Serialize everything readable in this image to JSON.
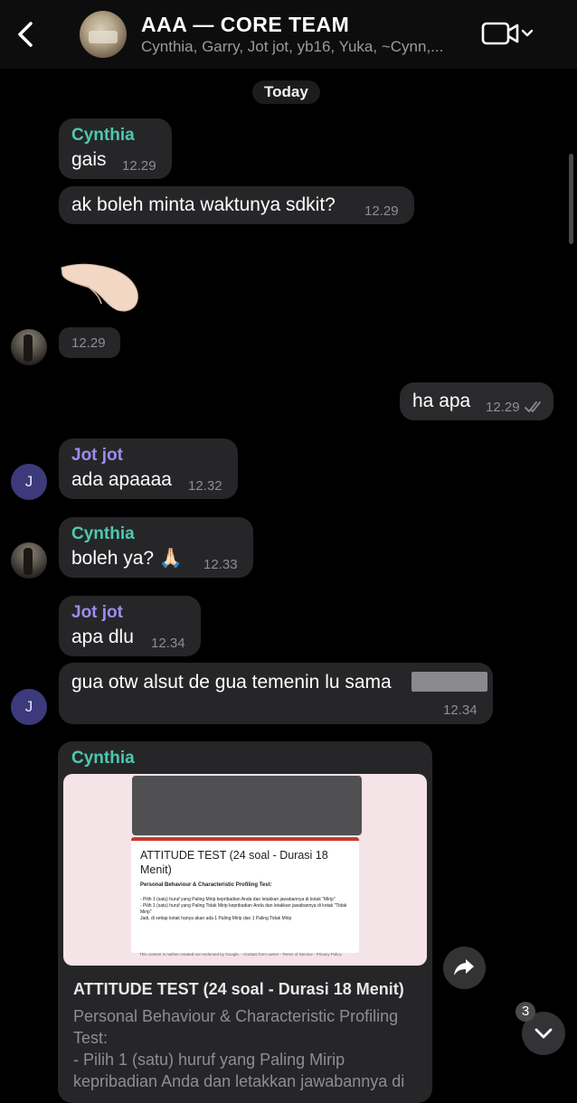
{
  "header": {
    "back_icon": "chevron-left-icon",
    "title": "AAA — CORE TEAM",
    "members": "Cynthia, Garry, Jot jot, yb16, Yuka, ~Cynn,...",
    "video_icon": "video-camera-icon",
    "dropdown_icon": "chevron-down-icon"
  },
  "date_separator": "Today",
  "messages": [
    {
      "sender": "Cynthia",
      "text": "gais",
      "time": "12.29"
    },
    {
      "text": "ak boleh minta waktunya sdkit?",
      "time": "12.29"
    },
    {
      "emoji": "pinching-hand",
      "time": "12.29"
    },
    {
      "text": "ha apa",
      "time": "12.29",
      "outgoing": true,
      "status": "read"
    },
    {
      "sender": "Jot jot",
      "text": "ada apaaaa",
      "time": "12.32",
      "avatar": "J"
    },
    {
      "sender": "Cynthia",
      "text": "boleh ya? 🙏🏻",
      "time": "12.33"
    },
    {
      "sender": "Jot jot",
      "text": "apa dlu",
      "time": "12.34"
    },
    {
      "text": "gua otw alsut de gua temenin lu sama",
      "time": "12.34",
      "avatar": "J"
    }
  ],
  "link_message": {
    "sender": "Cynthia",
    "preview": {
      "form_title": "ATTITUDE TEST (24 soal - Durasi 18 Menit)",
      "form_subtitle": "Personal Behaviour & Characteristic Profiling Test:",
      "form_body": "- Pilih 1 (satu) huruf yang Paling Mirip kepribadian Anda dan letakkan jawabannya di kotak \"Mirip\"\n- Pilih 1 (satu) huruf yang Paling Tidak Mirip kepribadian Anda dan letakkan jawabannya di kotak \"Tidak Mirip\"\nJadi, di setiap kotak hanya akan ada 1 Paling Mirip dan 1 Paling Tidak Mirip",
      "footer": "This content is neither created nor endorsed by Google. - Contact form owner - Terms of Service - Privacy Policy"
    },
    "title": "ATTITUDE TEST (24 soal - Durasi 18 Menit)",
    "description": "Personal Behaviour & Characteristic Profiling Test:\n- Pilih 1 (satu) huruf yang Paling Mirip kepribadian Anda dan letakkan jawabannya di"
  },
  "share_icon": "share-arrow-icon",
  "scroll_down": {
    "icon": "chevron-down-icon",
    "unread_count": "3"
  },
  "colors": {
    "background": "#000000",
    "bubble": "#262628",
    "cynthia": "#4dc9b0",
    "jotjot": "#9d8df1"
  }
}
